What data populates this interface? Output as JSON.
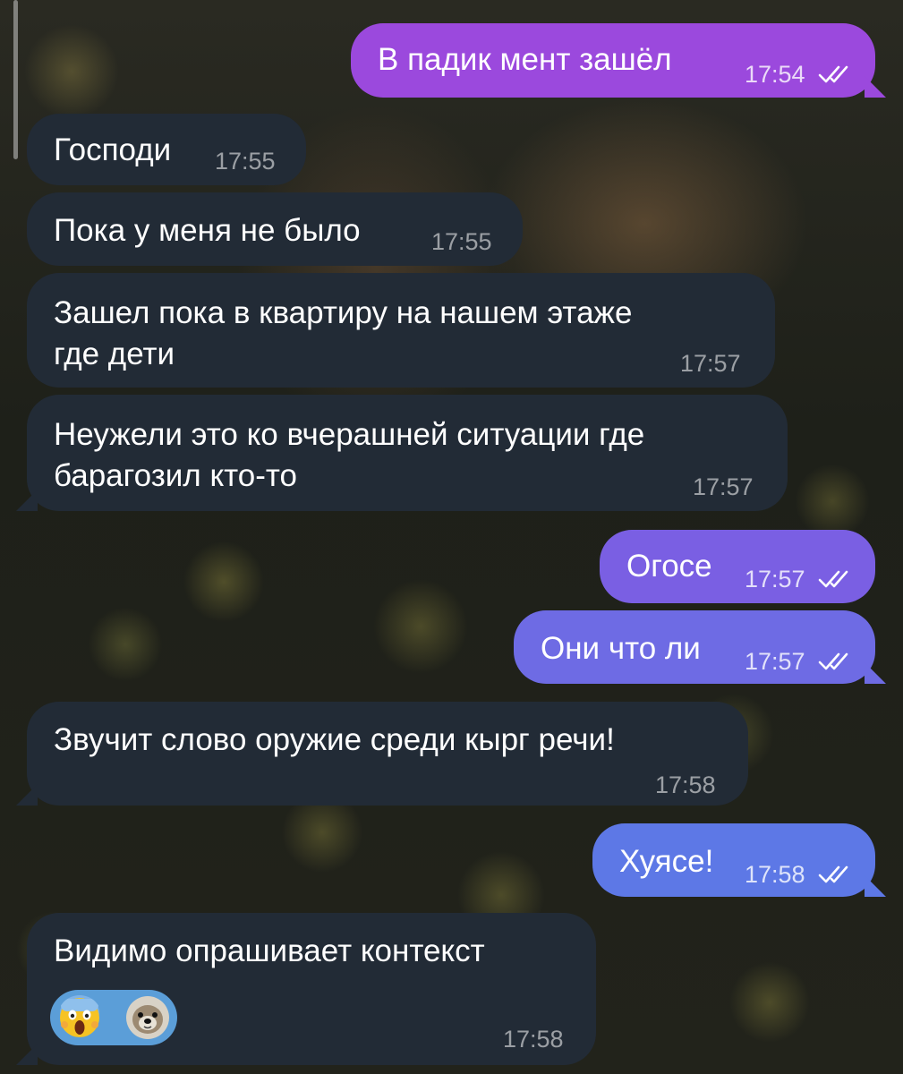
{
  "colors": {
    "incoming_bubble": "#222b36",
    "outgoing_gradient": [
      "#9b49dd",
      "#8a55e0",
      "#7c5fe2",
      "#6e6be4",
      "#5d78e6"
    ],
    "reaction_pill": "#5b9ed8",
    "read_ticks": "#ffffff"
  },
  "messages": [
    {
      "direction": "out",
      "text": "В падик мент зашёл",
      "time": "17:54",
      "read": true
    },
    {
      "direction": "in",
      "text": "Господи",
      "time": "17:55"
    },
    {
      "direction": "in",
      "text": "Пока у меня не было",
      "time": "17:55"
    },
    {
      "direction": "in",
      "text": "Зашел пока в квартиру на нашем этаже\nгде дети",
      "time": "17:57"
    },
    {
      "direction": "in",
      "text": "Неужели это ко вчерашней ситуации где\nбарагозил кто-то",
      "time": "17:57"
    },
    {
      "direction": "out",
      "text": "Огосе",
      "time": "17:57",
      "read": true
    },
    {
      "direction": "out",
      "text": "Они что ли",
      "time": "17:57",
      "read": true
    },
    {
      "direction": "in",
      "text": "Звучит слово оружие среди кырг речи!",
      "time": "17:58"
    },
    {
      "direction": "out",
      "text": "Хуясе!",
      "time": "17:58",
      "read": true
    },
    {
      "direction": "in",
      "text": "Видимо опрашивает контекст",
      "time": "17:58",
      "reactions": [
        "screaming-face-emoji",
        "dog-face-sticker"
      ]
    }
  ]
}
